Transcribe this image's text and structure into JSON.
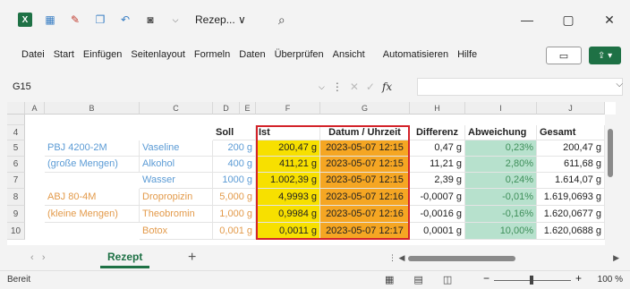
{
  "titlebar": {
    "app_icon": "X",
    "title": "Rezep... ∨",
    "icons": [
      "grid-icon",
      "brush-icon",
      "clipboard-icon",
      "undo-icon",
      "camera-icon",
      "dropdown-icon"
    ],
    "minimize": "—",
    "maximize": "▢",
    "close": "✕"
  },
  "ribbon": {
    "tabs": [
      "Datei",
      "Start",
      "Einfügen",
      "Seitenlayout",
      "Formeln",
      "Daten",
      "Überprüfen",
      "Ansicht",
      "Automatisieren",
      "Hilfe"
    ],
    "comment_label": "▭",
    "share_label": "⇪ ▾"
  },
  "formula_bar": {
    "name_box": "G15",
    "fx": "fx",
    "value": ""
  },
  "columns": [
    "A",
    "B",
    "C",
    "D",
    "E",
    "F",
    "G",
    "H",
    "I",
    "J"
  ],
  "rows": [
    {
      "num": "4",
      "B": "",
      "C": "",
      "D": "Soll",
      "F": "Ist",
      "G": "Datum / Uhrzeit",
      "H": "Differenz",
      "I": "Abweichung",
      "J": "Gesamt"
    },
    {
      "num": "5",
      "B": "PBJ 4200-2M",
      "C": "Vaseline",
      "D": "200 g",
      "F": "200,47 g",
      "G": "2023-05-07 12:15",
      "H": "0,47 g",
      "I": "0,23%",
      "J": "200,47 g"
    },
    {
      "num": "6",
      "B": "(große Mengen)",
      "C": "Alkohol",
      "D": "400 g",
      "F": "411,21 g",
      "G": "2023-05-07 12:15",
      "H": "11,21 g",
      "I": "2,80%",
      "J": "611,68 g"
    },
    {
      "num": "7",
      "B": "",
      "C": "Wasser",
      "D": "1000 g",
      "F": "1.002,39 g",
      "G": "2023-05-07 12:15",
      "H": "2,39 g",
      "I": "0,24%",
      "J": "1.614,07 g"
    },
    {
      "num": "8",
      "B": "ABJ 80-4M",
      "C": "Dropropizin",
      "D": "5,000 g",
      "F": "4,9993 g",
      "G": "2023-05-07 12:16",
      "H": "-0,0007 g",
      "I": "-0,01%",
      "J": "1.619,0693 g"
    },
    {
      "num": "9",
      "B": "(kleine Mengen)",
      "C": "Theobromin",
      "D": "1,000 g",
      "F": "0,9984 g",
      "G": "2023-05-07 12:16",
      "H": "-0,0016 g",
      "I": "-0,16%",
      "J": "1.620,0677 g"
    },
    {
      "num": "10",
      "B": "",
      "C": "Botox",
      "D": "0,001 g",
      "F": "0,0011 g",
      "G": "2023-05-07 12:17",
      "H": "0,0001 g",
      "I": "10,00%",
      "J": "1.620,0688 g"
    }
  ],
  "sheet_tabs": {
    "active": "Rezept",
    "add": "+"
  },
  "status": {
    "text": "Bereit",
    "zoom": "100 %"
  },
  "colors": {
    "excel_green": "#1e7145",
    "highlight_yellow": "#f7e000",
    "highlight_orange": "#f5a623",
    "deviation_green": "#b7e1cd",
    "box_red": "#d3232a"
  }
}
